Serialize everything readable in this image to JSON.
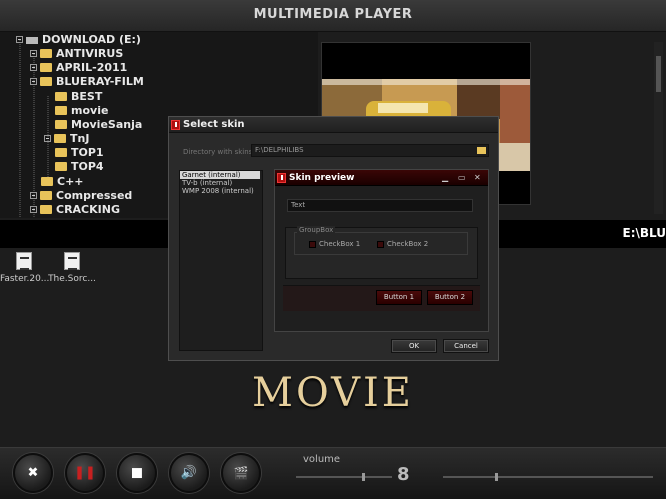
{
  "app": {
    "title": "MULTIMEDIA PLAYER"
  },
  "tree": {
    "root": "DOWNLOAD (E:)",
    "items": [
      "ANTIVIRUS",
      "APRIL-2011",
      "BLUERAY-FILM",
      "BEST",
      "movie",
      "MovieSanja",
      "TnJ",
      "TOP1",
      "TOP4",
      "C++",
      "Compressed",
      "CRACKING"
    ]
  },
  "path": {
    "text": "E:\\BLU"
  },
  "files": [
    {
      "label": "Faster.20..."
    },
    {
      "label": "The.Sorc..."
    }
  ],
  "now_playing": {
    "title": "MOVIE"
  },
  "controls": {
    "volume_label": "volume",
    "volume_value": "8"
  },
  "select_skin": {
    "title": "Select skin",
    "dir_label": "Directory with skins :",
    "dir_value": "F:\\DELPHILIBS",
    "skins": [
      "Garnet (internal)",
      "TV-b (internal)",
      "WMP 2008 (internal)"
    ],
    "ok": "OK",
    "cancel": "Cancel"
  },
  "preview": {
    "title": "Skin preview",
    "text": "Text",
    "groupbox": "GroupBox",
    "checkbox1": "CheckBox 1",
    "checkbox2": "CheckBox 2",
    "button1": "Button 1",
    "button2": "Button 2"
  },
  "colors": {
    "accent": "#e6cf9c",
    "folder": "#e8c35a",
    "skin_red": "#3a0606"
  }
}
